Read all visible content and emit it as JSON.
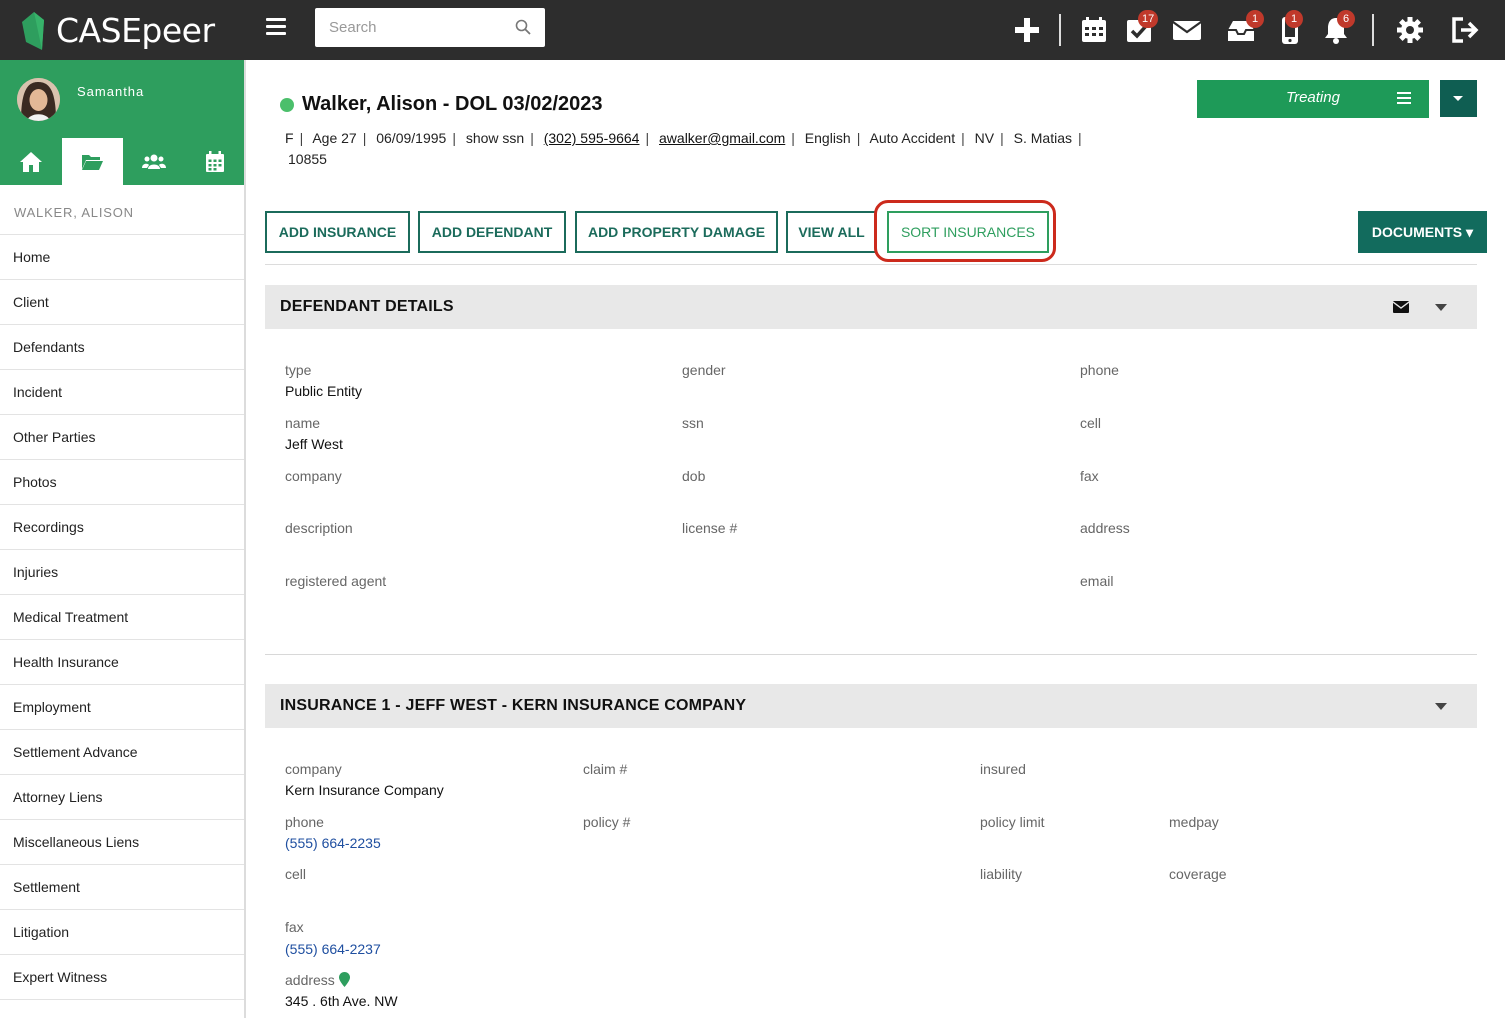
{
  "app": {
    "brand": "CASEpeer"
  },
  "header": {
    "search_placeholder": "Search",
    "badges": {
      "tasks": "17",
      "inbox": "1",
      "phone": "1",
      "notifications": "6"
    }
  },
  "sidebar": {
    "username": "Samantha",
    "case_name": "WALKER, ALISON",
    "items": [
      {
        "label": "Home"
      },
      {
        "label": "Client"
      },
      {
        "label": "Defendants"
      },
      {
        "label": "Incident"
      },
      {
        "label": "Other Parties"
      },
      {
        "label": "Photos"
      },
      {
        "label": "Recordings"
      },
      {
        "label": "Injuries"
      },
      {
        "label": "Medical Treatment"
      },
      {
        "label": "Health Insurance"
      },
      {
        "label": "Employment"
      },
      {
        "label": "Settlement Advance"
      },
      {
        "label": "Attorney Liens"
      },
      {
        "label": "Miscellaneous Liens"
      },
      {
        "label": "Settlement"
      },
      {
        "label": "Litigation"
      },
      {
        "label": "Expert Witness"
      }
    ]
  },
  "client": {
    "title": "Walker, Alison - DOL 03/02/2023",
    "sex": "F",
    "age": "Age 27",
    "dob": "06/09/1995",
    "ssn_link": "show ssn",
    "phone": "(302) 595-9664",
    "email": "awalker@gmail.com",
    "language": "English",
    "case_type": "Auto Accident",
    "state": "NV",
    "staff": "S. Matias",
    "case_id": "10855",
    "status": "Treating"
  },
  "actions": {
    "add_insurance": "ADD INSURANCE",
    "add_defendant": "ADD DEFENDANT",
    "add_property_damage": "ADD PROPERTY DAMAGE",
    "view_all": "VIEW ALL",
    "sort_insurances": "SORT INSURANCES",
    "documents": "DOCUMENTS ▾"
  },
  "defendant": {
    "section_title": "DEFENDANT DETAILS",
    "labels": {
      "type": "type",
      "name": "name",
      "company": "company",
      "description": "description",
      "registered_agent": "registered agent",
      "gender": "gender",
      "ssn": "ssn",
      "dob": "dob",
      "license": "license #",
      "phone": "phone",
      "cell": "cell",
      "fax": "fax",
      "address": "address",
      "email": "email"
    },
    "values": {
      "type": "Public Entity",
      "name": "Jeff West"
    }
  },
  "insurance": {
    "section_title": "INSURANCE 1 - JEFF WEST - KERN INSURANCE COMPANY",
    "labels": {
      "company": "company",
      "phone": "phone",
      "cell": "cell",
      "fax": "fax",
      "address": "address",
      "claim": "claim #",
      "policy": "policy #",
      "insured": "insured",
      "policy_limit": "policy limit",
      "liability": "liability",
      "medpay": "medpay",
      "coverage": "coverage"
    },
    "values": {
      "company": "Kern Insurance Company",
      "phone": "(555) 664-2235",
      "fax": "(555) 664-2237",
      "address": "345 . 6th Ave. NW"
    }
  },
  "colors": {
    "brand_green": "#2e9e5e",
    "dark_teal": "#126b5d",
    "topbar": "#2d2d2d",
    "badge_red": "#c0392b",
    "highlight_red": "#cc2a1c"
  }
}
